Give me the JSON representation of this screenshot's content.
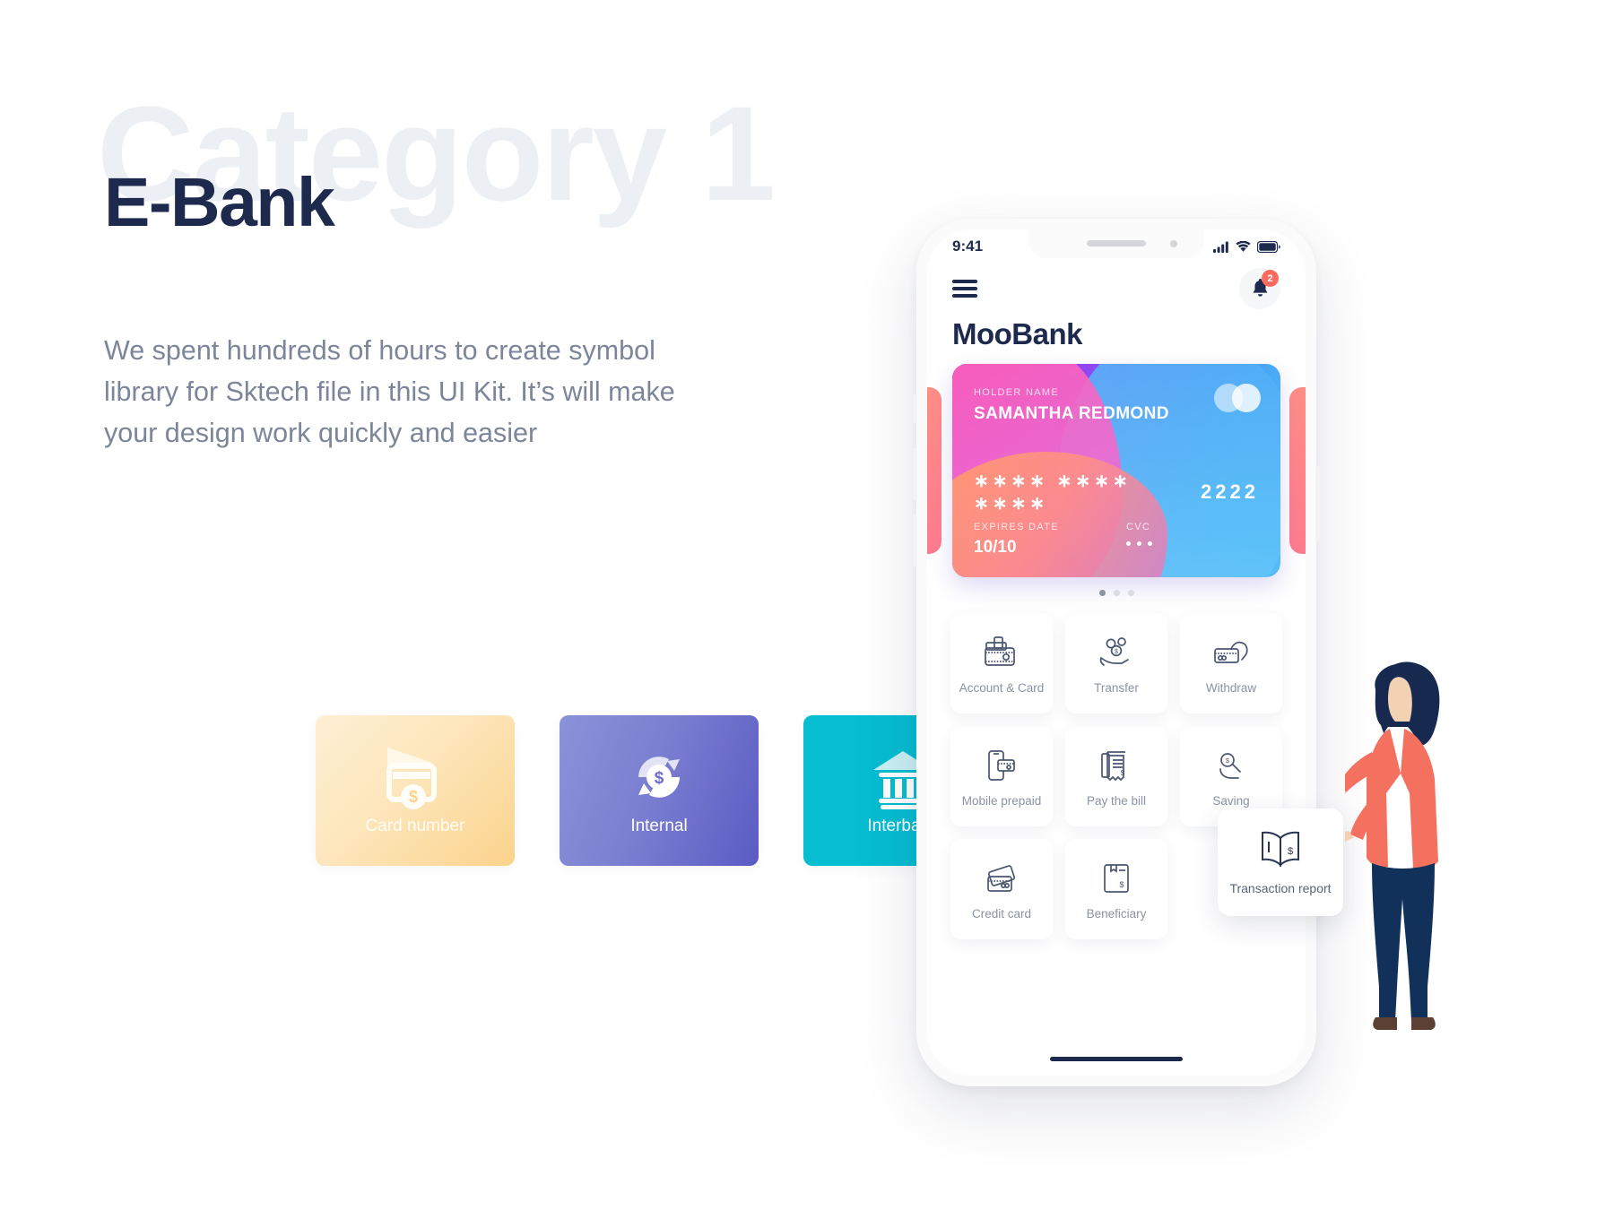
{
  "hero": {
    "ghost_title": "Category 1",
    "title": "E-Bank",
    "paragraph": "We spent hundreds of hours to create symbol library for Sktech file in this UI Kit. It’s will make your design work quickly and easier"
  },
  "buttons": [
    {
      "label": "Card number",
      "icon": "card-dollar-icon",
      "color": "#fbd38c"
    },
    {
      "label": "Internal",
      "icon": "refresh-dollar-icon",
      "color": "#5b5bc4"
    },
    {
      "label": "Interbank",
      "icon": "bank-building-icon",
      "color": "#06bdd1"
    }
  ],
  "phone": {
    "status": {
      "time": "9:41",
      "signal_icon": "cellular-signal-icon",
      "wifi_icon": "wifi-icon",
      "battery_icon": "battery-icon"
    },
    "appbar": {
      "menu_icon": "hamburger-menu-icon",
      "bell_icon": "notification-bell-icon",
      "badge_count": "2"
    },
    "brand": "MooBank",
    "card": {
      "holder_label": "HOLDER NAME",
      "holder_name": "SAMANTHA REDMOND",
      "number_masked": "∗∗∗∗  ∗∗∗∗  ∗∗∗∗",
      "number_last4": "2222",
      "expires_label": "EXPIRES DATE",
      "expires_value": "10/10",
      "cvc_label": "CVC",
      "cvc_value": "• • •",
      "logo_icon": "mastercard-icon"
    },
    "pager": {
      "count": 3,
      "active": 0
    },
    "menu": [
      {
        "label": "Account & Card",
        "icon": "wallet-cards-icon"
      },
      {
        "label": "Transfer",
        "icon": "hand-coins-icon"
      },
      {
        "label": "Withdraw",
        "icon": "hand-card-icon"
      },
      {
        "label": "Mobile prepaid",
        "icon": "phone-card-icon"
      },
      {
        "label": "Pay the bill",
        "icon": "receipt-dollar-icon"
      },
      {
        "label": "Saving",
        "icon": "piggy-dollar-icon"
      },
      {
        "label": "Credit card",
        "icon": "credit-cards-icon"
      },
      {
        "label": "Beneficiary",
        "icon": "document-dollar-icon"
      }
    ],
    "floating_tile": {
      "label": "Transaction report",
      "icon": "open-book-dollar-icon"
    }
  },
  "illustration": {
    "name": "woman-standing-illustration",
    "hair_color": "#1d2a4d",
    "jacket_color": "#f4705f",
    "shirt_color": "#ffffff",
    "pants_color": "#12315a",
    "skin_color": "#f3d2b3",
    "shoe_color": "#5c4033"
  },
  "colors": {
    "title": "#1d2a4d",
    "ghost": "#eceff4",
    "body_text": "#7c8599",
    "accent_teal": "#06bdd1",
    "badge_red": "#fd6a5e"
  }
}
